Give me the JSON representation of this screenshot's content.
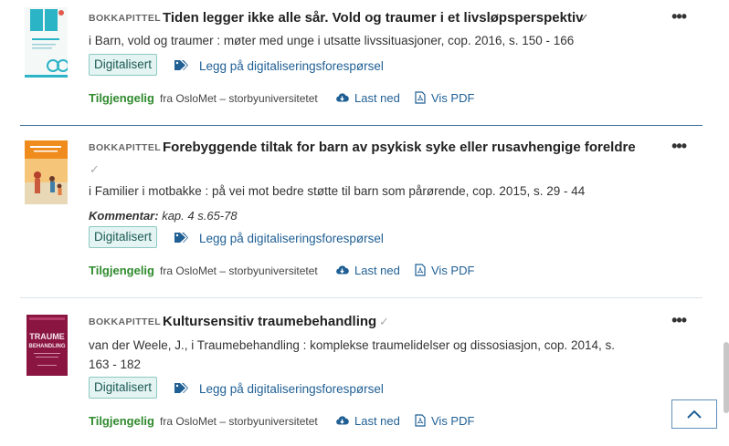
{
  "records": [
    {
      "type": "BOKKAPITTEL",
      "title": "Tiden legger ikke alle sår. Vold og traumer i et livsløpsperspektiv",
      "source": "i Barn, vold og traumer : møter med unge i utsatte livssituasjoner, cop. 2016, s. 150 - 166",
      "comment_label": "",
      "comment": "",
      "badge": "Digitalisert",
      "request_label": "Legg på digitaliseringsforespørsel",
      "availability": "Tilgjengelig",
      "from": "fra OsloMet – storbyuniversitetet",
      "download": "Last ned",
      "pdf": "Vis PDF"
    },
    {
      "type": "BOKKAPITTEL",
      "title": "Forebyggende tiltak for barn av psykisk syke eller rusavhengige foreldre",
      "source": "i Familier i motbakke : på vei mot bedre støtte til barn som pårørende, cop. 2015, s. 29 - 44",
      "comment_label": "Kommentar:",
      "comment": "kap. 4 s.65-78",
      "badge": "Digitalisert",
      "request_label": "Legg på digitaliseringsforespørsel",
      "availability": "Tilgjengelig",
      "from": "fra OsloMet – storbyuniversitetet",
      "download": "Last ned",
      "pdf": "Vis PDF"
    },
    {
      "type": "BOKKAPITTEL",
      "title": "Kultursensitiv traumebehandling",
      "source": "van der Weele, J., i Traumebehandling : komplekse traumelidelser og dissosiasjon, cop. 2014, s. 163 - 182",
      "comment_label": "",
      "comment": "",
      "badge": "Digitalisert",
      "request_label": "Legg på digitaliseringsforespørsel",
      "availability": "Tilgjengelig",
      "from": "fra OsloMet – storbyuniversitetet",
      "download": "Last ned",
      "pdf": "Vis PDF"
    }
  ],
  "more_menu": "•••",
  "cover_texts": {
    "cover3": "TRAUME BEHANDLING"
  },
  "colors": {
    "link": "#1f5f94",
    "available": "#2f8a2d",
    "badge_bg": "#e3f4f2",
    "badge_border": "#8ec9c2"
  },
  "icons": [
    "tag-icon",
    "cloud-download-icon",
    "pdf-icon",
    "check-icon",
    "more-icon",
    "chevron-up-icon"
  ]
}
